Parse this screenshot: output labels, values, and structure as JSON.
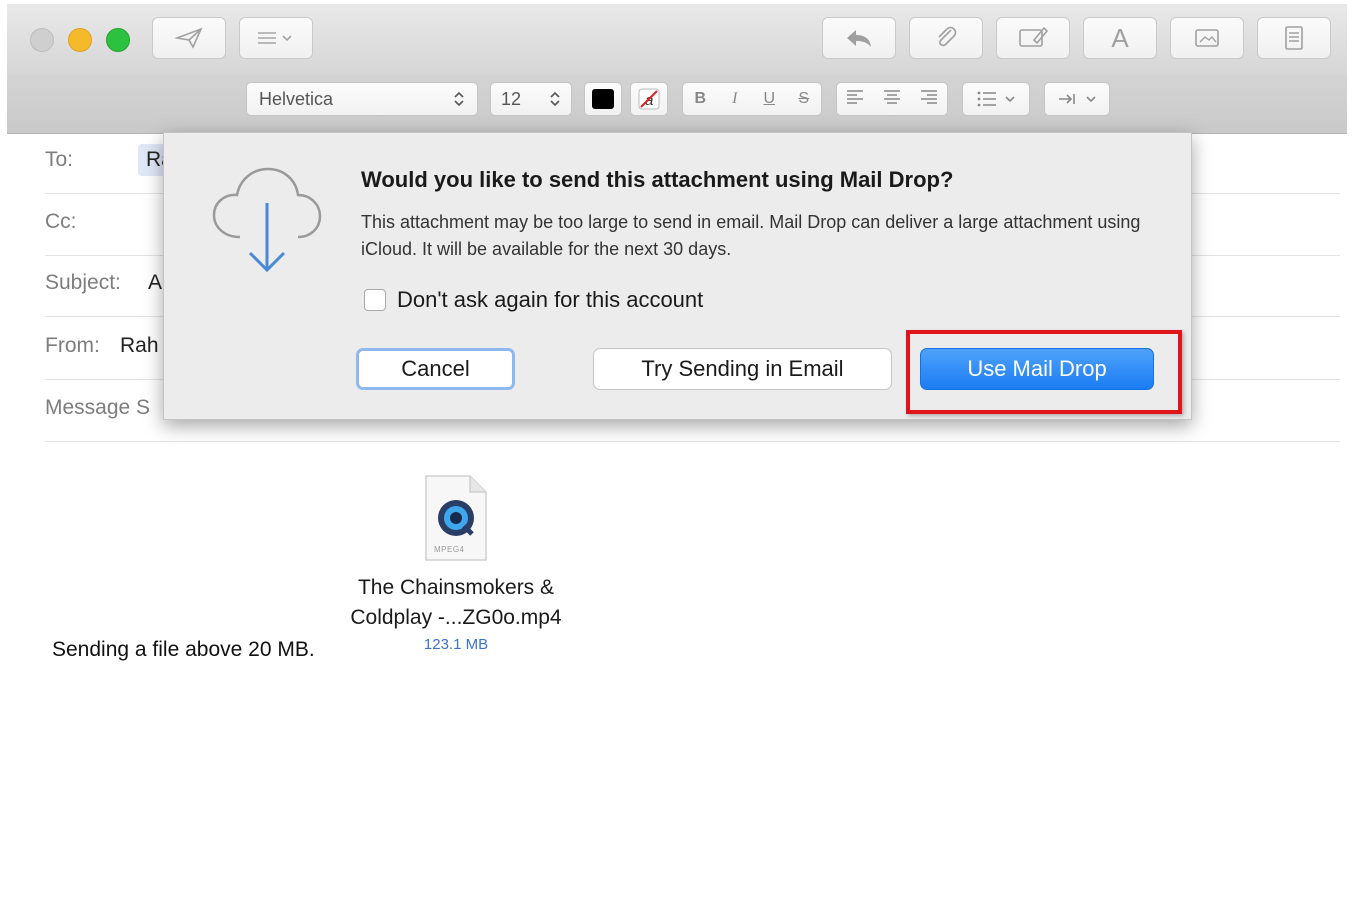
{
  "toolbar": {
    "buttons": [
      "send",
      "header-fields",
      "reply",
      "attach",
      "markup",
      "format",
      "photo-browser",
      "stationery"
    ]
  },
  "formatbar": {
    "font": "Helvetica",
    "size": "12",
    "bold": "B",
    "italic": "I",
    "underline": "U",
    "strike": "S"
  },
  "header": {
    "to_label": "To:",
    "to_value": "Rahu",
    "cc_label": "Cc:",
    "subject_label": "Subject:",
    "subject_value": "A",
    "from_label": "From:",
    "from_value": "Rah",
    "message_label": "Message S"
  },
  "dialog": {
    "title": "Would you like to send this attachment using Mail Drop?",
    "message": "This attachment may be too large to send in email. Mail Drop can deliver a large attachment using iCloud. It will be available for the next 30 days.",
    "checkbox_label": "Don't ask again for this account",
    "cancel": "Cancel",
    "try_email": "Try Sending in Email",
    "use_mail_drop": "Use Mail Drop"
  },
  "attachment": {
    "name": "The Chainsmokers & Coldplay -...ZG0o.mp4",
    "size": "123.1 MB",
    "type_label": "MPEG4"
  },
  "body": {
    "text": "Sending a file above 20 MB."
  },
  "colors": {
    "accent": "#1b7cf3",
    "highlight": "#e0141b"
  }
}
